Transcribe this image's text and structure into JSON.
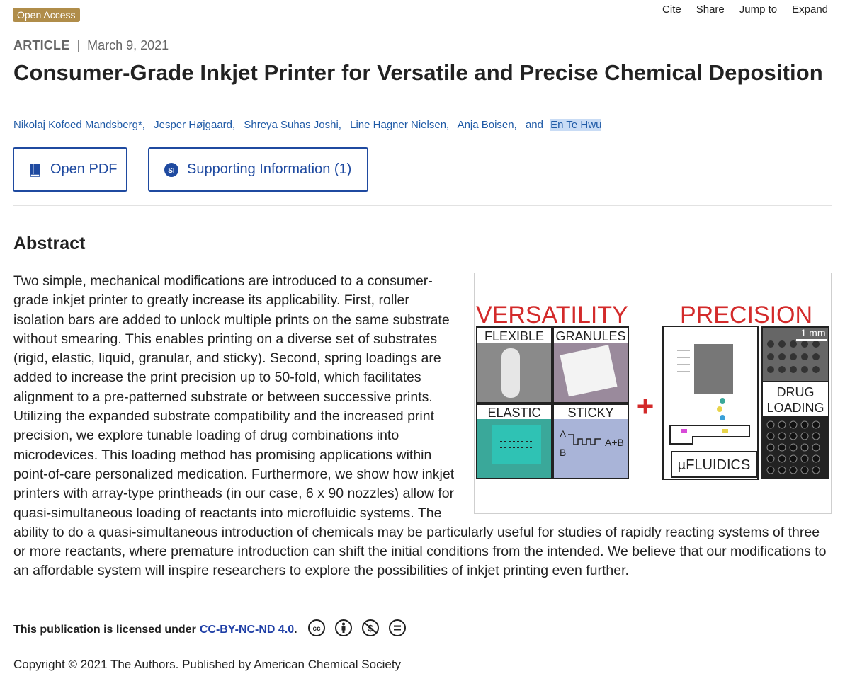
{
  "badge": "Open Access",
  "top_actions": [
    "Cite",
    "Share",
    "Jump to",
    "Expand"
  ],
  "article": {
    "type": "ARTICLE",
    "separator": "|",
    "date": "March 9, 2021"
  },
  "title": "Consumer-Grade Inkjet Printer for Versatile and Precise Chemical Deposition",
  "authors": [
    "Nikolaj Kofoed Mandsberg*",
    "Jesper Højgaard",
    "Shreya Suhas Joshi",
    "Line Hagner Nielsen",
    "Anja Boisen",
    "En Te Hwu"
  ],
  "authors_and": "and",
  "buttons": {
    "pdf": "Open PDF",
    "si": "Supporting Information (1)",
    "si_badge": "SI"
  },
  "abstract": {
    "heading": "Abstract",
    "text": "Two simple, mechanical modifications are introduced to a consumer-grade inkjet printer to greatly increase its applicability. First, roller isolation bars are added to unlock multiple prints on the same substrate without smearing. This enables printing on a diverse set of substrates (rigid, elastic, liquid, granular, and sticky). Second, spring loadings are added to increase the print precision up to 50-fold, which facilitates alignment to a pre-patterned substrate or between successive prints. Utilizing the expanded substrate compatibility and the increased print precision, we explore tunable loading of drug combinations into microdevices. This loading method has promising applications within point-of-care personalized medication. Furthermore, we show how inkjet printers with array-type printheads (in our case, 6 x 90 nozzles) allow for quasi-simultaneous loading of reactants into microfluidic systems. The ability to do a quasi-simultaneous introduction of chemicals may be particularly useful for studies of rapidly reacting systems of three or more reactants, where premature introduction can shift the initial conditions from the intended. We believe that our modifications to an affordable system will inspire researchers to explore the possibilities of inkjet printing even further."
  },
  "figure": {
    "versatility": "VERSATILITY",
    "precision": "PRECISION",
    "flexible": "FLEXIBLE",
    "granules": "GRANULES",
    "elastic": "ELASTIC",
    "sticky": "STICKY",
    "scale": "1 mm",
    "drug": "DRUG",
    "loading": "LOADING",
    "fluidics": "µFLUIDICS",
    "plus": "+",
    "label_a": "A",
    "label_b": "B",
    "label_ab": "A+B",
    "accent_color": "#d32a2a"
  },
  "license": {
    "prefix": "This publication is licensed under",
    "link": "CC-BY-NC-ND 4.0",
    "suffix": ".",
    "icons": [
      "cc-icon",
      "by-icon",
      "nc-icon",
      "nd-icon"
    ]
  },
  "copyright": "Copyright © 2021 The Authors. Published by American Chemical Society"
}
